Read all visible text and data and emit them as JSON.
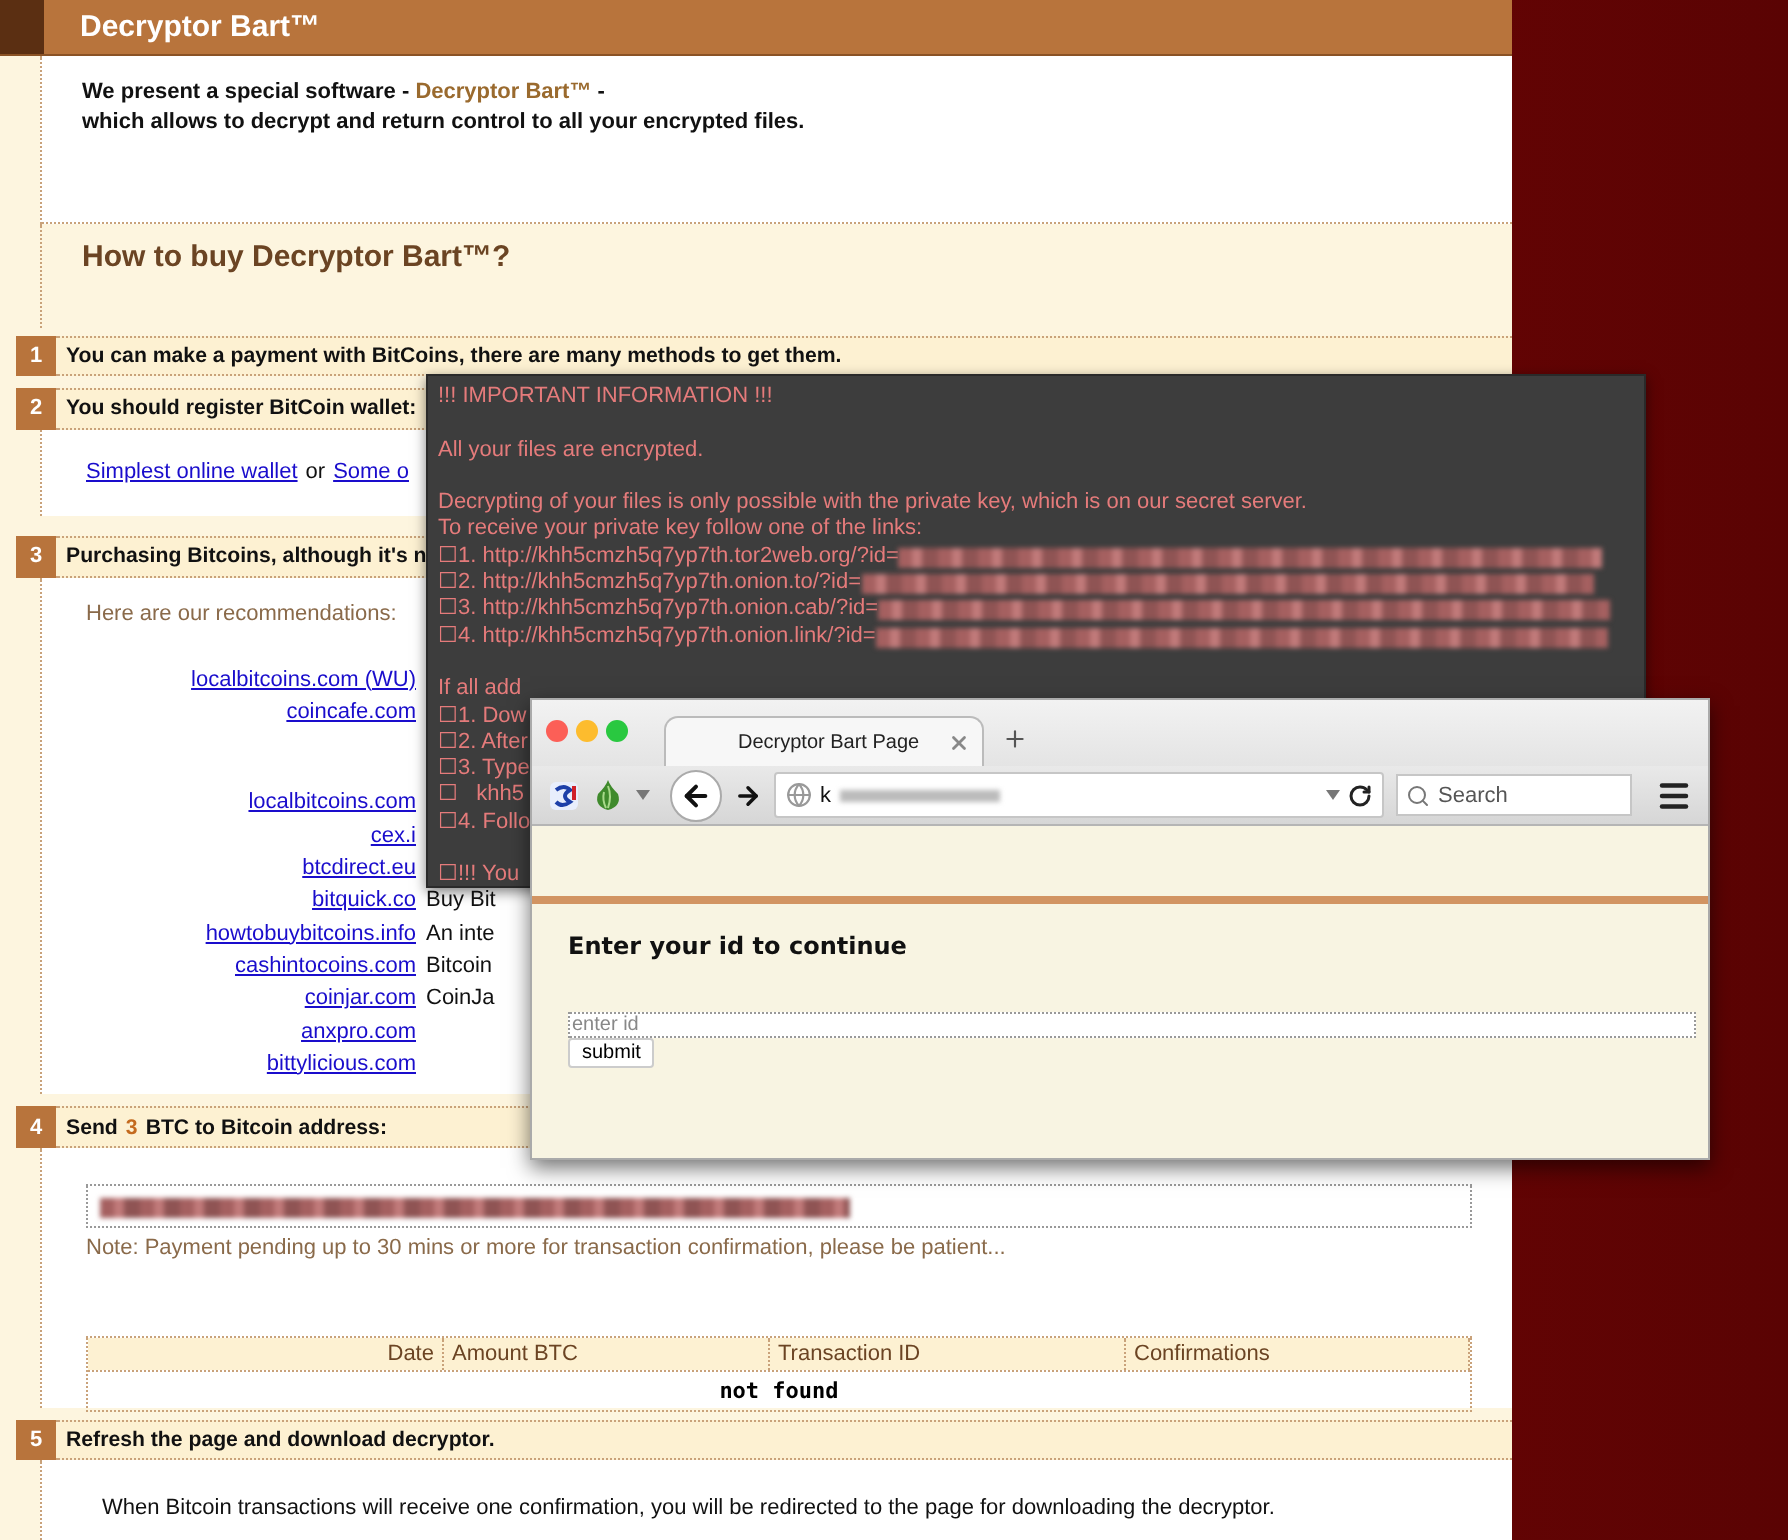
{
  "page": {
    "title": "Decryptor Bart™",
    "intro": {
      "lead": "We present a special software -",
      "product": "Decryptor Bart™",
      "tail": "-",
      "line2": "which allows to decrypt and return control to all your encrypted files."
    },
    "heading": "How to buy Decryptor Bart™?",
    "steps": [
      {
        "number": "1",
        "kind": "plain",
        "text": "You can make a payment with BitCoins, there are many methods to get them."
      },
      {
        "number": "2",
        "kind": "wallets",
        "text": "You should register BitCoin wallet:",
        "links": [
          "Simplest online wallet",
          "Some o"
        ],
        "joiner": "or"
      },
      {
        "number": "3",
        "kind": "recommendations",
        "text": "Purchasing Bitcoins, although it's n",
        "intro": "Here are our recommendations:",
        "groups": [
          [
            {
              "site": "localbitcoins.com (WU)"
            },
            {
              "site": "coincafe.com"
            }
          ],
          [
            {
              "site": "localbitcoins.com"
            },
            {
              "site": "cex.i"
            },
            {
              "site": "btcdirect.eu"
            },
            {
              "site": "bitquick.co",
              "note": "Buy Bit"
            },
            {
              "site": "howtobuybitcoins.info",
              "note": "An inte"
            },
            {
              "site": "cashintocoins.com",
              "note": "Bitcoin"
            },
            {
              "site": "coinjar.com",
              "note": "CoinJa"
            },
            {
              "site": "anxpro.com"
            },
            {
              "site": "bittylicious.com"
            }
          ]
        ]
      },
      {
        "number": "4",
        "kind": "payment",
        "prefix": "Send",
        "amount": "3",
        "suffix": "BTC to Bitcoin address:",
        "note": "Note: Payment pending up to 30 mins or more for transaction confirmation, please be patient...",
        "table": {
          "columns": [
            "Date",
            "Amount BTC",
            "Transaction ID",
            "Confirmations"
          ],
          "empty": "not found"
        }
      },
      {
        "number": "5",
        "kind": "download",
        "text": "Refresh the page and download decryptor.",
        "paragraph": "When Bitcoin transactions will receive one confirmation, you will be redirected to the page for downloading the decryptor."
      }
    ]
  },
  "terminal": {
    "lines": [
      {
        "kind": "text",
        "text": "!!! IMPORTANT INFORMATION !!!"
      },
      {
        "kind": "blank"
      },
      {
        "kind": "text",
        "text": "All your files are encrypted."
      },
      {
        "kind": "blank"
      },
      {
        "kind": "text",
        "text": "Decrypting of your files is only possible with the private key, which is on our secret server."
      },
      {
        "kind": "text",
        "text": "To receive your private key follow one of the links:"
      },
      {
        "kind": "link",
        "text": "☐1. http://khh5cmzh5q7yp7th.tor2web.org/?id="
      },
      {
        "kind": "link",
        "text": "☐2. http://khh5cmzh5q7yp7th.onion.to/?id="
      },
      {
        "kind": "link",
        "text": "☐3. http://khh5cmzh5q7yp7th.onion.cab/?id="
      },
      {
        "kind": "link",
        "text": "☐4. http://khh5cmzh5q7yp7th.onion.link/?id="
      },
      {
        "kind": "blank"
      },
      {
        "kind": "text",
        "text": "If all add"
      },
      {
        "kind": "text",
        "text": "☐1. Dow"
      },
      {
        "kind": "text",
        "text": "☐2. After"
      },
      {
        "kind": "text",
        "text": "☐3. Type"
      },
      {
        "kind": "text",
        "text": "☐   khh5"
      },
      {
        "kind": "text",
        "text": "☐4. Follo"
      },
      {
        "kind": "blank"
      },
      {
        "kind": "text",
        "text": "☐!!! You"
      }
    ]
  },
  "browser": {
    "tabs": [
      {
        "label": "Decryptor Bart Page",
        "selected": true
      }
    ],
    "url": "k",
    "search": {
      "placeholder": "Search"
    },
    "content": {
      "heading": "Enter your id to continue",
      "field": {
        "placeholder": "enter id"
      },
      "button": "submit"
    }
  }
}
